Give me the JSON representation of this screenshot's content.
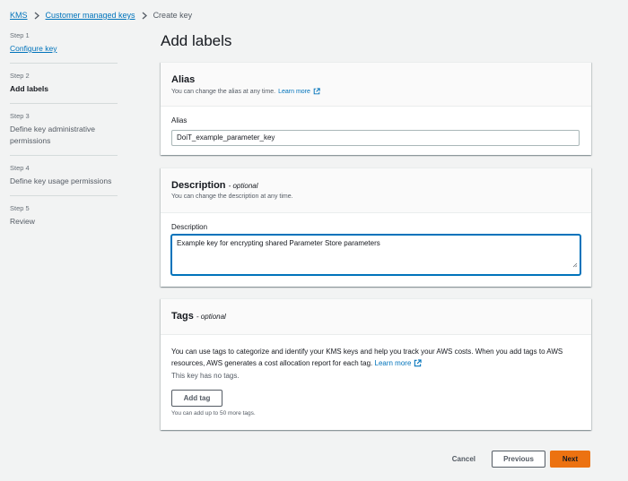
{
  "breadcrumb": {
    "items": [
      "KMS",
      "Customer managed keys"
    ],
    "current": "Create key"
  },
  "steps": [
    {
      "num": "Step 1",
      "title": "Configure key",
      "state": "link"
    },
    {
      "num": "Step 2",
      "title": "Add labels",
      "state": "active"
    },
    {
      "num": "Step 3",
      "title": "Define key administrative permissions",
      "state": "inactive"
    },
    {
      "num": "Step 4",
      "title": "Define key usage permissions",
      "state": "inactive"
    },
    {
      "num": "Step 5",
      "title": "Review",
      "state": "inactive"
    }
  ],
  "page_title": "Add labels",
  "alias_panel": {
    "title": "Alias",
    "desc": "You can change the alias at any time.",
    "learn_more": "Learn more",
    "field_label": "Alias",
    "value": "DoiT_example_parameter_key"
  },
  "description_panel": {
    "title": "Description",
    "optional": "- optional",
    "desc": "You can change the description at any time.",
    "field_label": "Description",
    "value": "Example key for encrypting shared Parameter Store parameters"
  },
  "tags_panel": {
    "title": "Tags",
    "optional": "- optional",
    "body_text": "You can use tags to categorize and identify your KMS keys and help you track your AWS costs. When you add tags to AWS resources, AWS generates a cost allocation report for each tag.",
    "learn_more": "Learn more",
    "no_tags": "This key has no tags.",
    "add_tag_label": "Add tag",
    "limit_text": "You can add up to 50 more tags."
  },
  "footer": {
    "cancel": "Cancel",
    "previous": "Previous",
    "next": "Next"
  },
  "colors": {
    "link": "#0073bb",
    "primary_button": "#ec7211",
    "background": "#f2f3f3"
  },
  "icons": [
    "chevron-right-icon",
    "external-link-icon",
    "resize-handle-icon"
  ]
}
